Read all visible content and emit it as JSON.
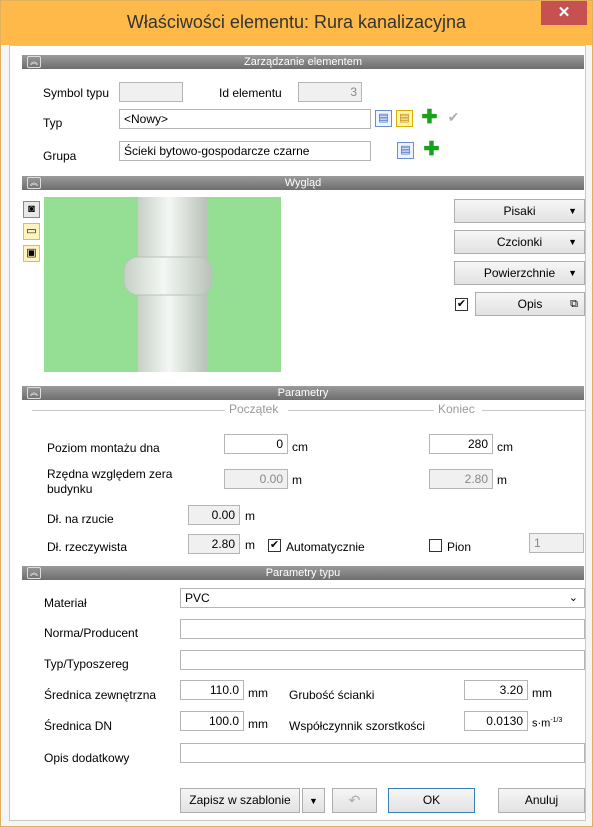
{
  "title": "Właściwości elementu: Rura kanalizacyjna",
  "sections": {
    "management": "Zarządzanie elementem",
    "appearance": "Wygląd",
    "params": "Parametry",
    "type_params": "Parametry typu"
  },
  "management": {
    "symbol_label": "Symbol typu",
    "symbol_value": "",
    "id_label": "Id elementu",
    "id_value": "3",
    "type_label": "Typ",
    "type_value": "<Nowy>",
    "group_label": "Grupa",
    "group_value": "Ścieki bytowo-gospodarcze czarne"
  },
  "appearance": {
    "pens": "Pisaki",
    "fonts": "Czcionki",
    "surfaces": "Powierzchnie",
    "description": "Opis",
    "description_checked": true,
    "preview_bg": "#94df94"
  },
  "params": {
    "col_start": "Początek",
    "col_end": "Koniec",
    "mount_label": "Poziom montażu dna",
    "mount_start": "0",
    "mount_start_unit": "cm",
    "mount_end": "280",
    "mount_end_unit": "cm",
    "ordinate_label": "Rzędna względem zera budynku",
    "ordinate_start": "0.00",
    "ordinate_start_unit": "m",
    "ordinate_end": "2.80",
    "ordinate_end_unit": "m",
    "proj_label": "Dł. na rzucie",
    "proj_value": "0.00",
    "proj_unit": "m",
    "real_label": "Dł. rzeczywista",
    "real_value": "2.80",
    "real_unit": "m",
    "auto_label": "Automatycznie",
    "auto_checked": true,
    "vertical_label": "Pion",
    "vertical_checked": false,
    "vertical_value": "1"
  },
  "type_params": {
    "material_label": "Materiał",
    "material_value": "PVC",
    "norm_label": "Norma/Producent",
    "norm_value": "",
    "series_label": "Typ/Typoszereg",
    "series_value": "",
    "ext_diam_label": "Średnica zewnętrzna",
    "ext_diam_value": "110.0",
    "ext_diam_unit": "mm",
    "wall_label": "Grubość ścianki",
    "wall_value": "3.20",
    "wall_unit": "mm",
    "dn_label": "Średnica DN",
    "dn_value": "100.0",
    "dn_unit": "mm",
    "rough_label": "Współczynnik szorstkości",
    "rough_value": "0.0130",
    "rough_unit": "s·m",
    "rough_unit_exp": "-1/3",
    "extra_label": "Opis dodatkowy",
    "extra_value": ""
  },
  "footer": {
    "save_template": "Zapisz w szablonie",
    "ok": "OK",
    "cancel": "Anuluj"
  },
  "colors": {
    "titlebar": "#ffb948",
    "close": "#c75050",
    "section": "#808080",
    "add_green": "#1aa01a"
  }
}
